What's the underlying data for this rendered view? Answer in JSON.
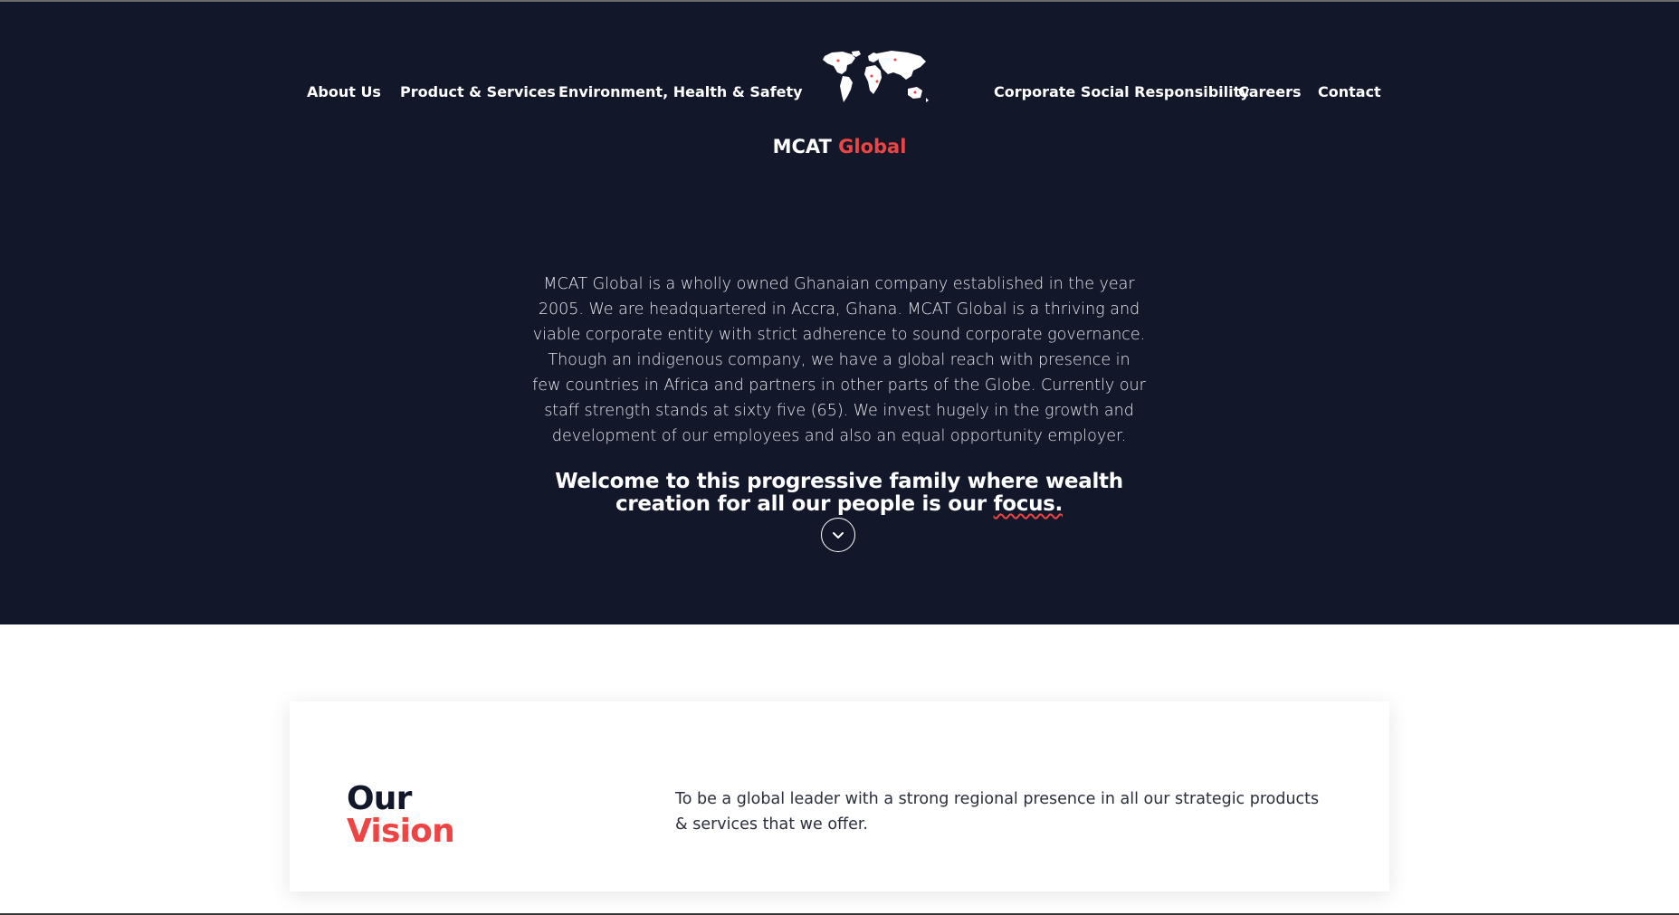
{
  "nav": {
    "left": [
      {
        "label": "About Us"
      },
      {
        "label": "Product & Services"
      },
      {
        "label": "Environment, Health & Safety"
      }
    ],
    "right": [
      {
        "label": "Corporate Social Responsibility"
      },
      {
        "label": "Careers"
      },
      {
        "label": "Contact"
      }
    ]
  },
  "brand": {
    "name": "MCAT",
    "accent": "Global",
    "logo_icon": "world-map-icon"
  },
  "hero": {
    "intro": "MCAT Global is a wholly owned Ghanaian company established in the year 2005. We are headquartered in Accra, Ghana. MCAT Global is a thriving and viable corporate entity with strict adherence to sound corporate governance. Though an indigenous company, we have a global reach with presence in few countries in Africa and partners in other parts of the Globe. Currently our staff strength stands at sixty five (65). We invest hugely in the growth and development of our employees and also an equal opportunity employer.",
    "welcome_main": "Welcome to this progressive family where wealth creation for all our people is our ",
    "welcome_focus": "focus.",
    "scroll_icon": "chevron-down-icon"
  },
  "vision": {
    "title_line1": "Our",
    "title_line2": "Vision",
    "text": "To be a global leader with a strong regional presence in all our strategic products & services that we offer."
  },
  "colors": {
    "background": "#121829",
    "accent": "#ef4444",
    "text": "#ffffff"
  }
}
